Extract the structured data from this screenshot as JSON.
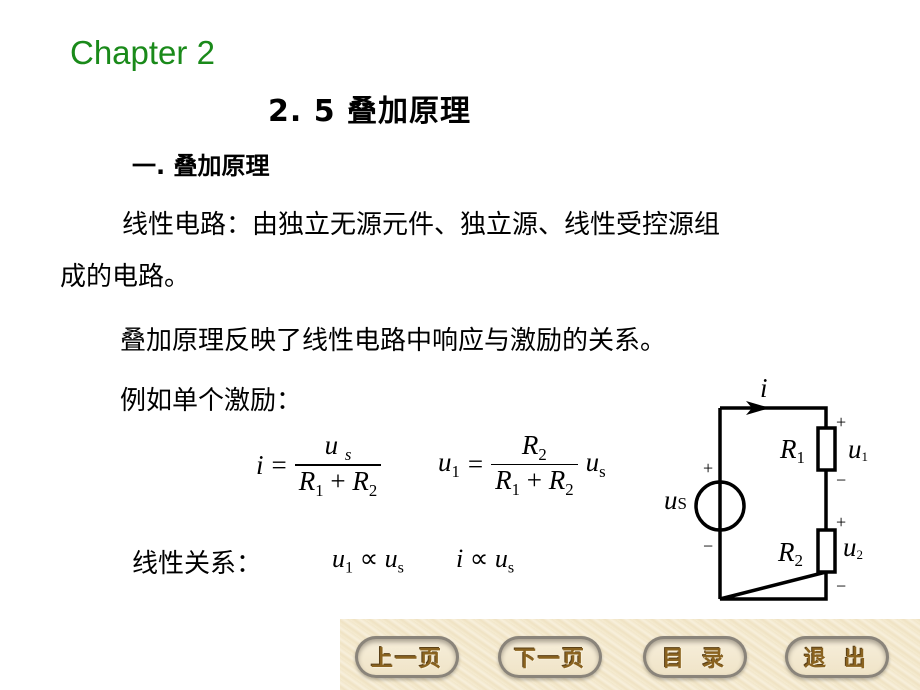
{
  "slide": {
    "chapter": "Chapter 2",
    "section_title": "2. 5  叠加原理",
    "subsection_title": "一. 叠加原理",
    "paragraphs": {
      "linear_circuit_def_line1": "线性电路：由独立无源元件、独立源、线性受控源组",
      "linear_circuit_def_line2": "成的电路。",
      "superposition_statement": "叠加原理反映了线性电路中响应与激励的关系。",
      "example_intro": "例如单个激励：",
      "linear_relation_label": "线性关系："
    },
    "equations": {
      "eq1": {
        "lhs": "i",
        "equals": "=",
        "numerator": "u",
        "numerator_sub": "s",
        "denominator": [
          "R",
          "1",
          " + ",
          "R",
          "2"
        ]
      },
      "eq2": {
        "lhs": "u",
        "lhs_sub": "1",
        "equals": "=",
        "numerator": "R",
        "numerator_sub": "2",
        "denominator": [
          "R",
          "1",
          " + ",
          "R",
          "2"
        ],
        "factor": "u",
        "factor_sub": "s"
      },
      "rel1": {
        "a": "u",
        "a_sub": "1",
        "op": " ∝ ",
        "b": "u",
        "b_sub": "s"
      },
      "rel2": {
        "a": "i",
        "op": " ∝ ",
        "b": "u",
        "b_sub": "s"
      }
    },
    "circuit": {
      "current_label": "i",
      "source_label": "u",
      "source_sub": "S",
      "source_plus": "+",
      "source_minus": "−",
      "r1_label": "R",
      "r1_sub": "1",
      "r2_label": "R",
      "r2_sub": "2",
      "u1_label": "u",
      "u1_sub": "1",
      "u2_label": "u",
      "u2_sub": "2",
      "plus": "+",
      "minus": "−"
    }
  },
  "navigation": {
    "prev_page": "上一页",
    "next_page": "下一页",
    "contents": "目录",
    "exit": "退出"
  }
}
